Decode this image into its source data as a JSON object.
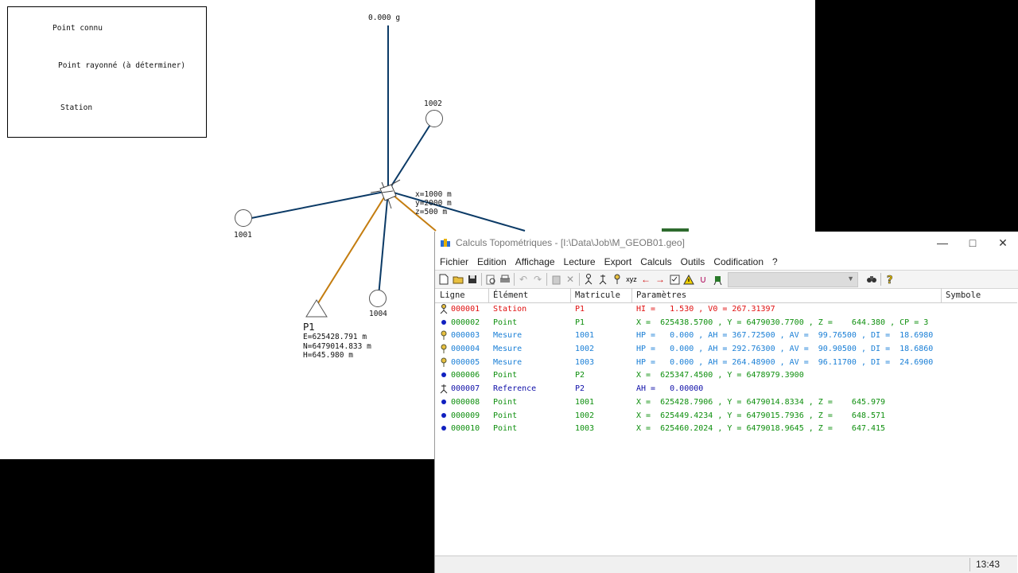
{
  "canvas": {
    "north_label": "0.000 g",
    "legend": {
      "known": "Point connu",
      "radiated": "Point rayonné (à déterminer)",
      "station": "Station"
    },
    "station_coords": [
      "x=1000 m",
      "y=2000 m",
      "z=500 m"
    ],
    "points": {
      "p1001": "1001",
      "p1002": "1002",
      "p1004": "1004",
      "p1": "P1"
    },
    "p1_coords": [
      "E=625428.791 m",
      "N=6479014.833 m",
      "H=645.980 m"
    ]
  },
  "window": {
    "title": "Calculs Topométriques - [I:\\Data\\Job\\M_GEOB01.geo]",
    "menu": [
      "Fichier",
      "Edition",
      "Affichage",
      "Lecture",
      "Export",
      "Calculs",
      "Outils",
      "Codification",
      "?"
    ],
    "columns": {
      "ligne": "Ligne",
      "element": "Élément",
      "matricule": "Matricule",
      "parametres": "Paramètres",
      "symbole": "Symbole"
    },
    "rows": [
      {
        "ligne": "000001",
        "element": "Station",
        "matricule": "P1",
        "params": "HI =   1.530 , V0 = 267.31397",
        "color": "#e01010",
        "icon": "station-icon"
      },
      {
        "ligne": "000002",
        "element": "Point",
        "matricule": "P1",
        "params": "X =  625438.5700 , Y = 6479030.7700 , Z =    644.380 , CP = 3",
        "color": "#0e8f0e",
        "icon": "point-dot-icon"
      },
      {
        "ligne": "000003",
        "element": "Mesure",
        "matricule": "1001",
        "params": "HP =   0.000 , AH = 367.72500 , AV =  99.76500 , DI =  18.6980",
        "color": "#1a7fd6",
        "icon": "measure-pin-icon"
      },
      {
        "ligne": "000004",
        "element": "Mesure",
        "matricule": "1002",
        "params": "HP =   0.000 , AH = 292.76300 , AV =  90.90500 , DI =  18.6860",
        "color": "#1a7fd6",
        "icon": "measure-pin-icon"
      },
      {
        "ligne": "000005",
        "element": "Mesure",
        "matricule": "1003",
        "params": "HP =   0.000 , AH = 264.48900 , AV =  96.11700 , DI =  24.6900",
        "color": "#1a7fd6",
        "icon": "measure-pin-icon"
      },
      {
        "ligne": "000006",
        "element": "Point",
        "matricule": "P2",
        "params": "X =  625347.4500 , Y = 6478979.3900",
        "color": "#0e8f0e",
        "icon": "point-dot-icon"
      },
      {
        "ligne": "000007",
        "element": "Reference",
        "matricule": "P2",
        "params": "AH =   0.00000",
        "color": "#1010a8",
        "icon": "reference-icon"
      },
      {
        "ligne": "000008",
        "element": "Point",
        "matricule": "1001",
        "params": "X =  625428.7906 , Y = 6479014.8334 , Z =    645.979",
        "color": "#0e8f0e",
        "icon": "point-dot-icon"
      },
      {
        "ligne": "000009",
        "element": "Point",
        "matricule": "1002",
        "params": "X =  625449.4234 , Y = 6479015.7936 , Z =    648.571",
        "color": "#0e8f0e",
        "icon": "point-dot-icon"
      },
      {
        "ligne": "000010",
        "element": "Point",
        "matricule": "1003",
        "params": "X =  625460.2024 , Y = 6479018.9645 , Z =    647.415",
        "color": "#0e8f0e",
        "icon": "point-dot-icon"
      }
    ],
    "status_time": "13:43"
  }
}
